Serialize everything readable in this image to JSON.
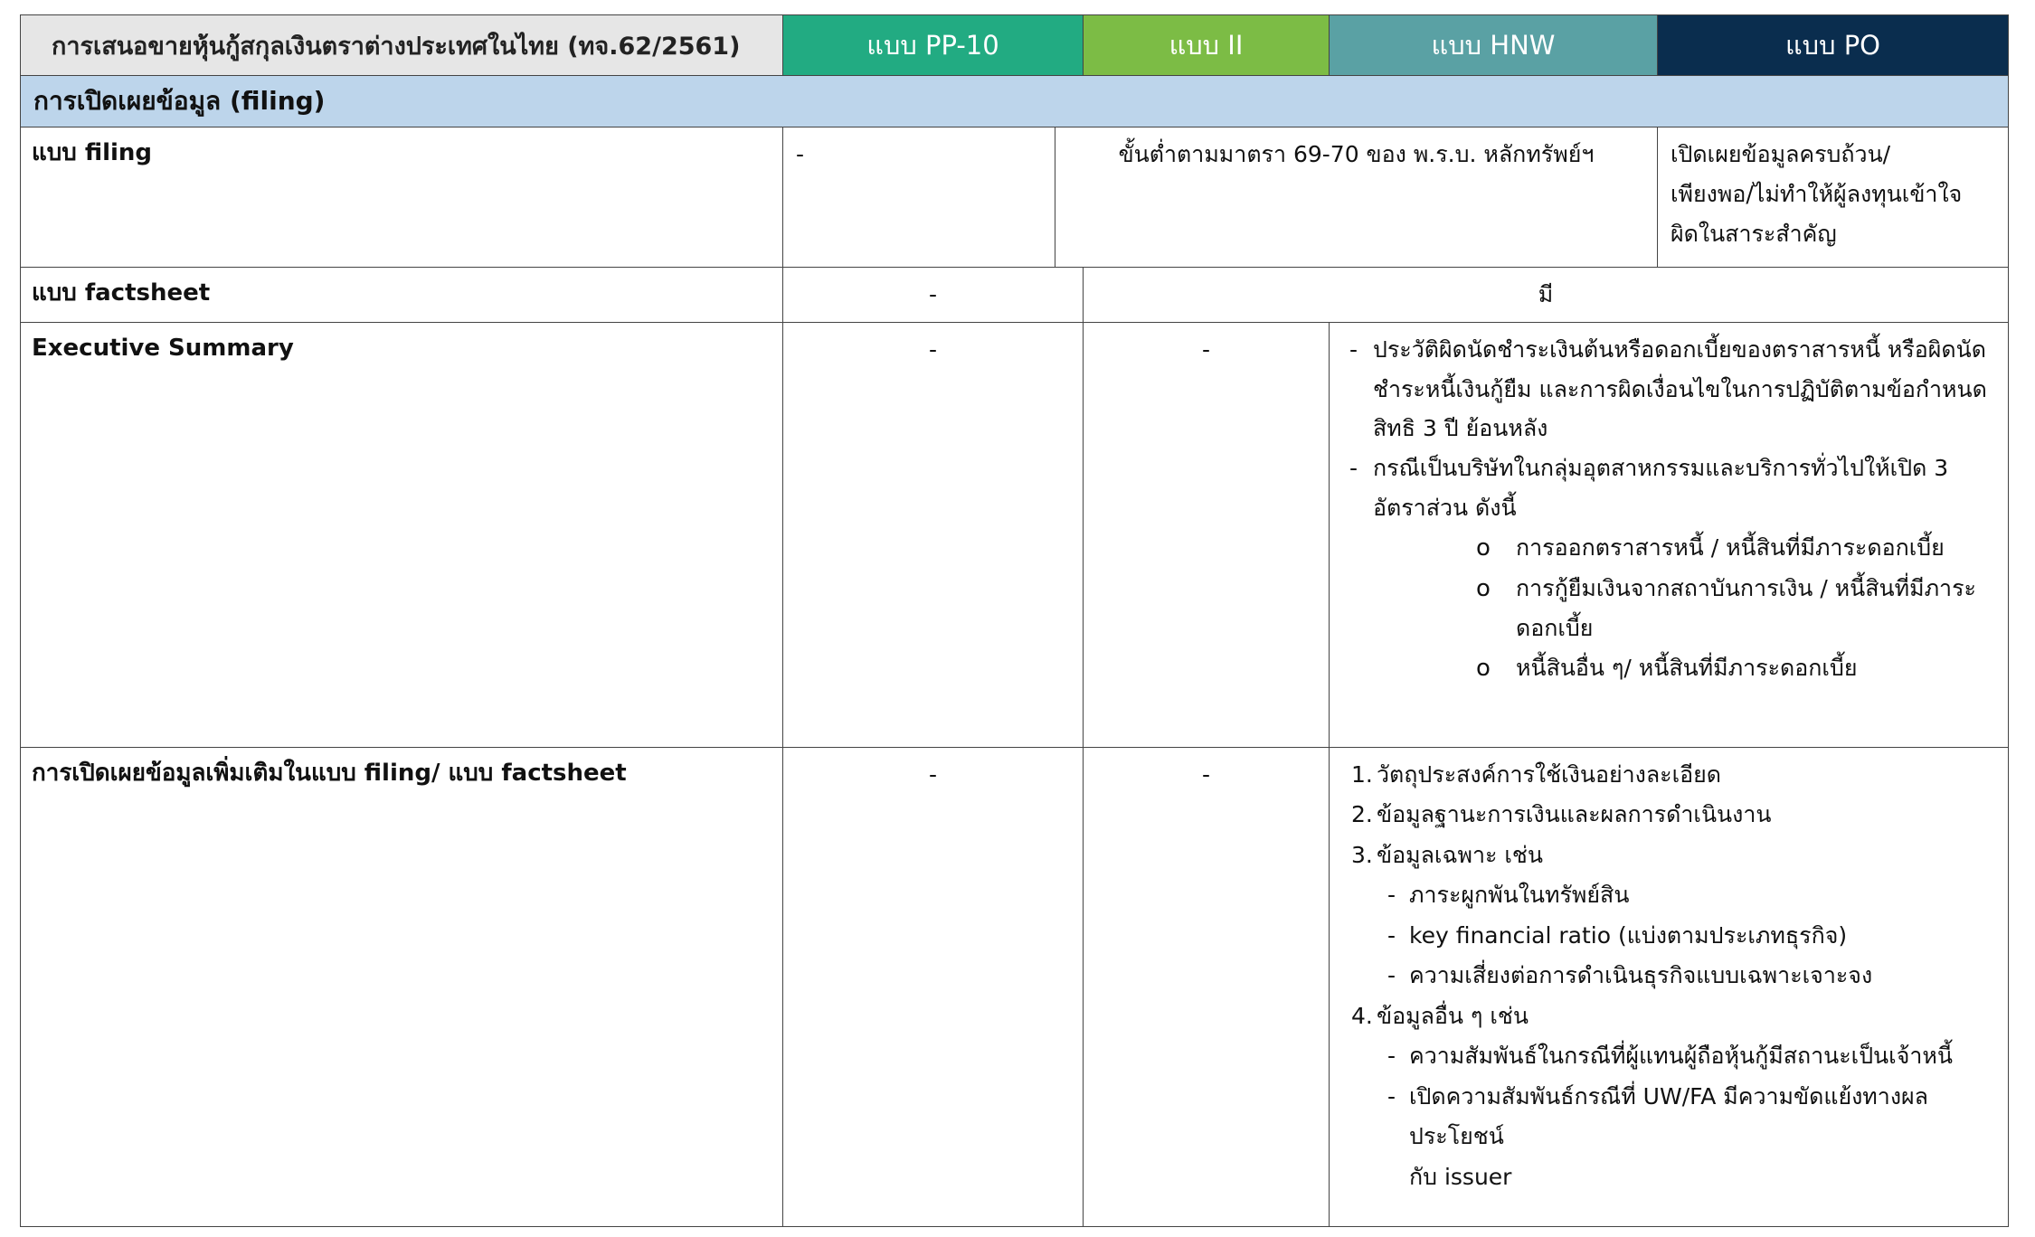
{
  "header": {
    "title": "การเสนอขายหุ้นกู้สกุลเงินตราต่างประเทศในไทย (ทจ.62/2561)",
    "cols": [
      "แบบ PP-10",
      "แบบ II",
      "แบบ HNW",
      "แบบ PO"
    ]
  },
  "section": {
    "title": "การเปิดเผยข้อมูล (filing)"
  },
  "rows": {
    "filing": {
      "label": "แบบ filing",
      "pp10": "-",
      "mid": "ขั้นต่ำตามมาตรา 69-70 ของ พ.ร.บ. หลักทรัพย์ฯ",
      "po_lines": [
        "เปิดเผยข้อมูลครบถ้วน/",
        "เพียงพอ/ไม่ทำให้ผู้ลงทุนเข้าใจ",
        "ผิดในสาระสำคัญ"
      ]
    },
    "factsheet": {
      "label": "แบบ factsheet",
      "pp10": "-",
      "rest": "มี"
    },
    "exec": {
      "label": "Executive Summary",
      "pp10": "-",
      "ii": "-",
      "dash_mark": "-",
      "item1": [
        "ประวัติผิดนัดชำระเงินต้นหรือดอกเบี้ยของตราสารหนี้ หรือผิดนัด",
        "ชำระหนี้เงินกู้ยืม และการผิดเงื่อนไขในการปฏิบัติตามข้อกำหนด",
        "สิทธิ 3 ปี ย้อนหลัง"
      ],
      "item2": [
        "กรณีเป็นบริษัทในกลุ่มอุตสาหกรรมและบริการทั่วไปให้เปิด 3",
        "อัตราส่วน ดังนี้"
      ],
      "bullet_mark": "o",
      "bullets": [
        [
          "การออกตราสารหนี้ / หนี้สินที่มีภาระดอกเบี้ย"
        ],
        [
          "การกู้ยืมเงินจากสถาบันการเงิน / หนี้สินที่มีภาระ",
          "ดอกเบี้ย"
        ],
        [
          "หนี้สินอื่น ๆ/ หนี้สินที่มีภาระดอกเบี้ย"
        ]
      ]
    },
    "additional": {
      "label": "การเปิดเผยข้อมูลเพิ่มเติมในแบบ filing/ แบบ factsheet",
      "pp10": "-",
      "ii": "-",
      "n1": "1.",
      "t1": "วัตถุประสงค์การใช้เงินอย่างละเอียด",
      "n2": "2.",
      "t2": "ข้อมูลฐานะการเงินและผลการดำเนินงาน",
      "n3": "3.",
      "t3": "ข้อมูลเฉพาะ เช่น",
      "s3": [
        "ภาระผูกพันในทรัพย์สิน",
        "key financial ratio (แบ่งตามประเภทธุรกิจ)",
        "ความเสี่ยงต่อการดำเนินธุรกิจแบบเฉพาะเจาะจง"
      ],
      "n4": "4.",
      "t4": "ข้อมูลอื่น ๆ เช่น",
      "s4a": "ความสัมพันธ์ในกรณีที่ผู้แทนผู้ถือหุ้นกู้มีสถานะเป็นเจ้าหนี้",
      "s4b": [
        "เปิดความสัมพันธ์กรณีที่ UW/FA มีความขัดแย้งทางผลประโยชน์",
        "กับ issuer"
      ],
      "sub_mark": "-"
    }
  }
}
